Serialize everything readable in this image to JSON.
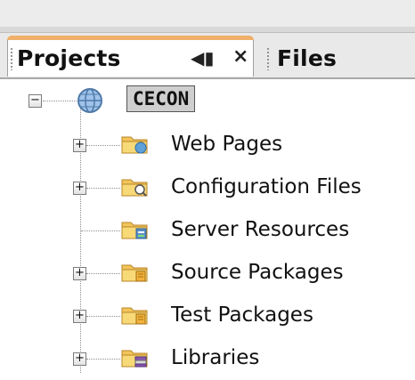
{
  "tabs": {
    "projects": {
      "label": "Projects",
      "minimize_icon": "minimize-icon",
      "close_icon": "close-icon",
      "active": true
    },
    "files": {
      "label": "Files"
    }
  },
  "tree": {
    "root": {
      "label": "CECON",
      "icon": "web-project-globe-icon",
      "expanded": true
    },
    "items": [
      {
        "label": "Web Pages",
        "icon": "web-pages-folder-icon",
        "expandable": true
      },
      {
        "label": "Configuration Files",
        "icon": "config-files-folder-icon",
        "expandable": true
      },
      {
        "label": "Server Resources",
        "icon": "server-resources-folder-icon",
        "expandable": false
      },
      {
        "label": "Source Packages",
        "icon": "source-packages-folder-icon",
        "expandable": true
      },
      {
        "label": "Test Packages",
        "icon": "test-packages-folder-icon",
        "expandable": true
      },
      {
        "label": "Libraries",
        "icon": "libraries-folder-icon",
        "expandable": true
      }
    ]
  }
}
